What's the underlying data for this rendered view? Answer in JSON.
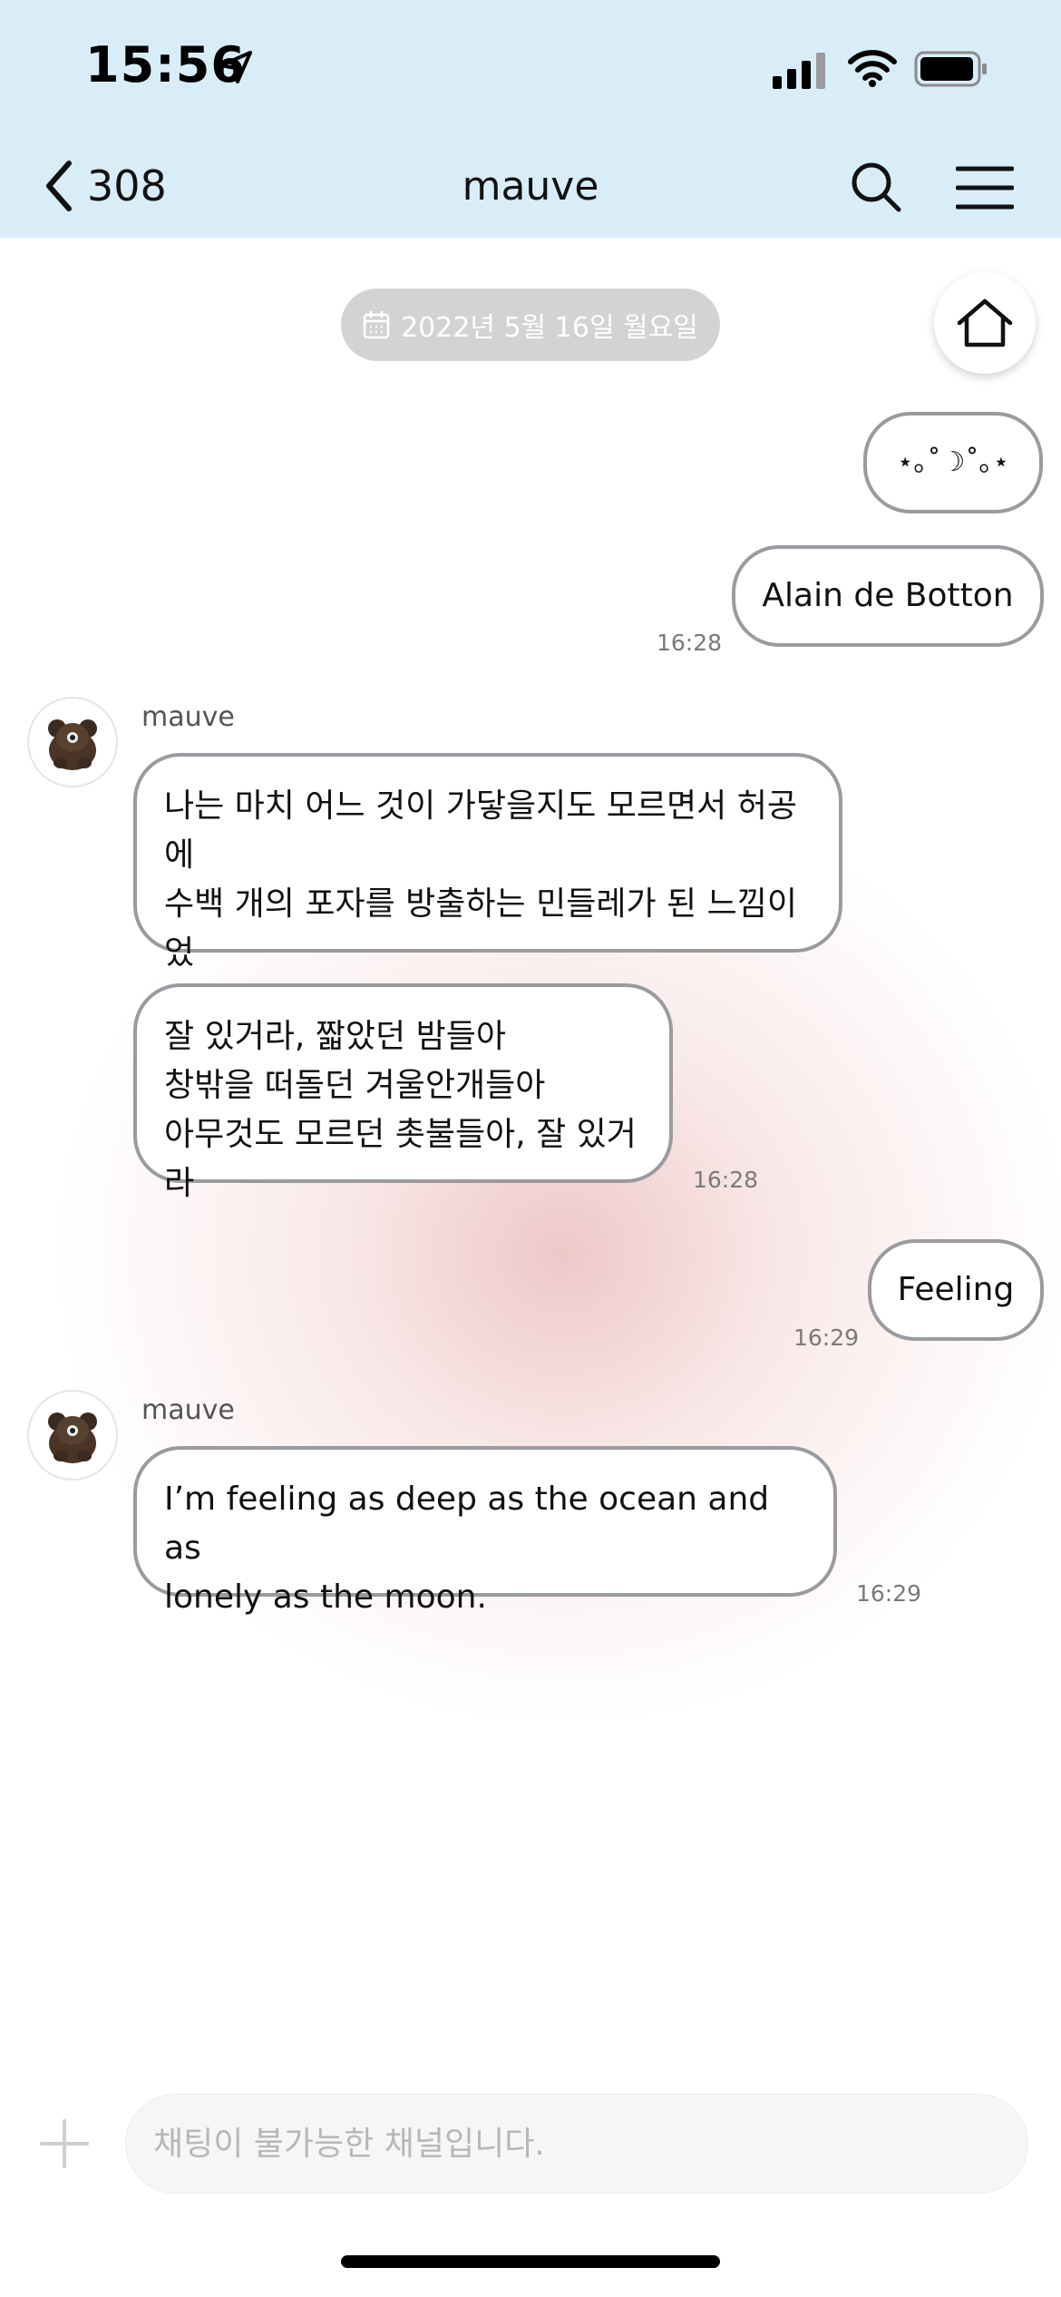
{
  "status_bar": {
    "time": "15:56"
  },
  "nav": {
    "back_label": "308",
    "title": "mauve"
  },
  "chat": {
    "date_label": "2022년 5월 16일 월요일",
    "messages": [
      {
        "side": "right",
        "text": "⋆｡˚☽˚｡⋆"
      },
      {
        "side": "right",
        "text": "Alain de Botton",
        "time": "16:28"
      },
      {
        "side": "left",
        "sender": "mauve",
        "text": "나는 마치 어느 것이 가닿을지도 모르면서 허공에\n수백 개의 포자를 방출하는 민들레가 된 느낌이었\n다."
      },
      {
        "side": "left",
        "text": "잘 있거라, 짧았던 밤들아\n창밖을 떠돌던 겨울안개들아\n아무것도 모르던 촛불들아, 잘 있거라",
        "time": "16:28"
      },
      {
        "side": "right",
        "text": "Feeling",
        "time": "16:29"
      },
      {
        "side": "left",
        "sender": "mauve",
        "text": "I’m feeling as deep as the ocean and as\nlonely as the moon.",
        "time": "16:29"
      }
    ]
  },
  "input": {
    "placeholder": "채팅이 불가능한 채널입니다."
  },
  "icons": {
    "back": "chevron-left-icon",
    "search": "search-icon",
    "menu": "hamburger-menu-icon",
    "home": "home-icon",
    "plus": "plus-icon",
    "calendar": "calendar-icon",
    "avatar": "bear-avatar"
  },
  "colors": {
    "header_bg": "#d9edf9",
    "bubble_border": "#9a9aa0",
    "date_pill_bg": "#d3d3d3",
    "glow": "#ecbebe"
  }
}
